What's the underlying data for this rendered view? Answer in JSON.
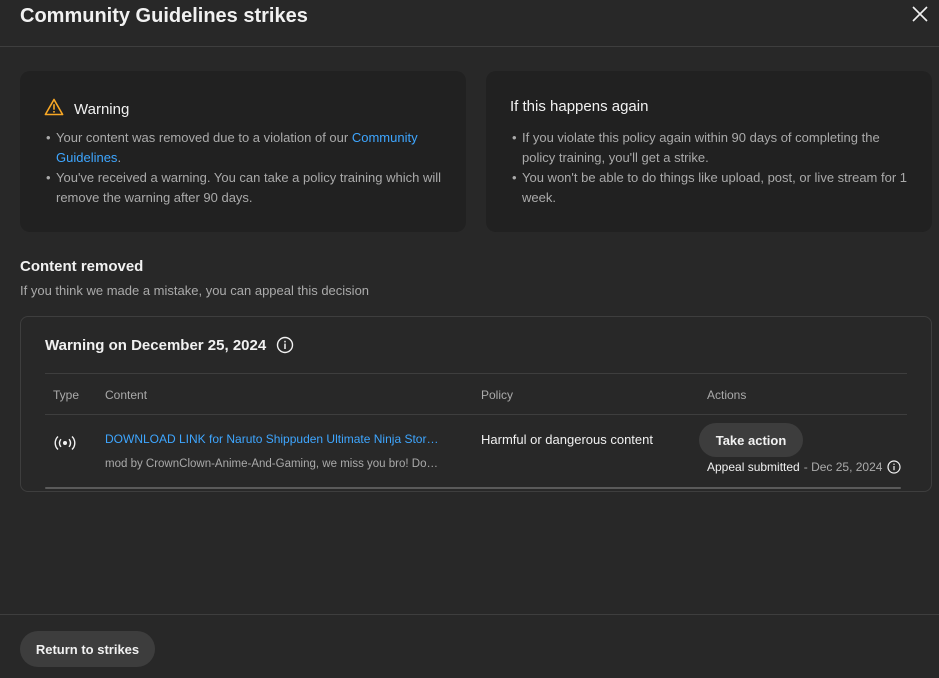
{
  "dialog": {
    "title": "Community Guidelines strikes"
  },
  "warning_card": {
    "heading": "Warning",
    "bullet1_text": "Your content was removed due to a violation of our ",
    "bullet1_link": "Community Guidelines",
    "bullet1_end": ".",
    "bullet2": "You've received a warning. You can take a policy training which will remove the warning after 90 days."
  },
  "again_card": {
    "heading": "If this happens again",
    "bullet1": "If you violate this policy again within 90 days of completing the policy training, you'll get a strike.",
    "bullet2": "You won't be able to do things like upload, post, or live stream for 1 week."
  },
  "content_removed": {
    "title": "Content removed",
    "subtitle": "If you think we made a mistake, you can appeal this decision"
  },
  "panel": {
    "heading": "Warning on December 25, 2024",
    "columns": [
      "Type",
      "Content",
      "Policy",
      "Actions"
    ],
    "row": {
      "type_icon": "live-broadcast-icon",
      "content_title": "DOWNLOAD LINK for Naruto Shippuden Ultimate Ninja Stor…",
      "content_desc": "mod by CrownClown-Anime-And-Gaming, we miss you bro! Do…",
      "policy": "Harmful or dangerous content",
      "action_label": "Take action",
      "appeal_status": "Appeal submitted",
      "appeal_date": "- Dec 25, 2024"
    }
  },
  "footer": {
    "return_label": "Return to strikes"
  },
  "colors": {
    "background": "#282828",
    "card": "#212121",
    "link": "#3ea6ff",
    "warning": "#f9a825"
  }
}
